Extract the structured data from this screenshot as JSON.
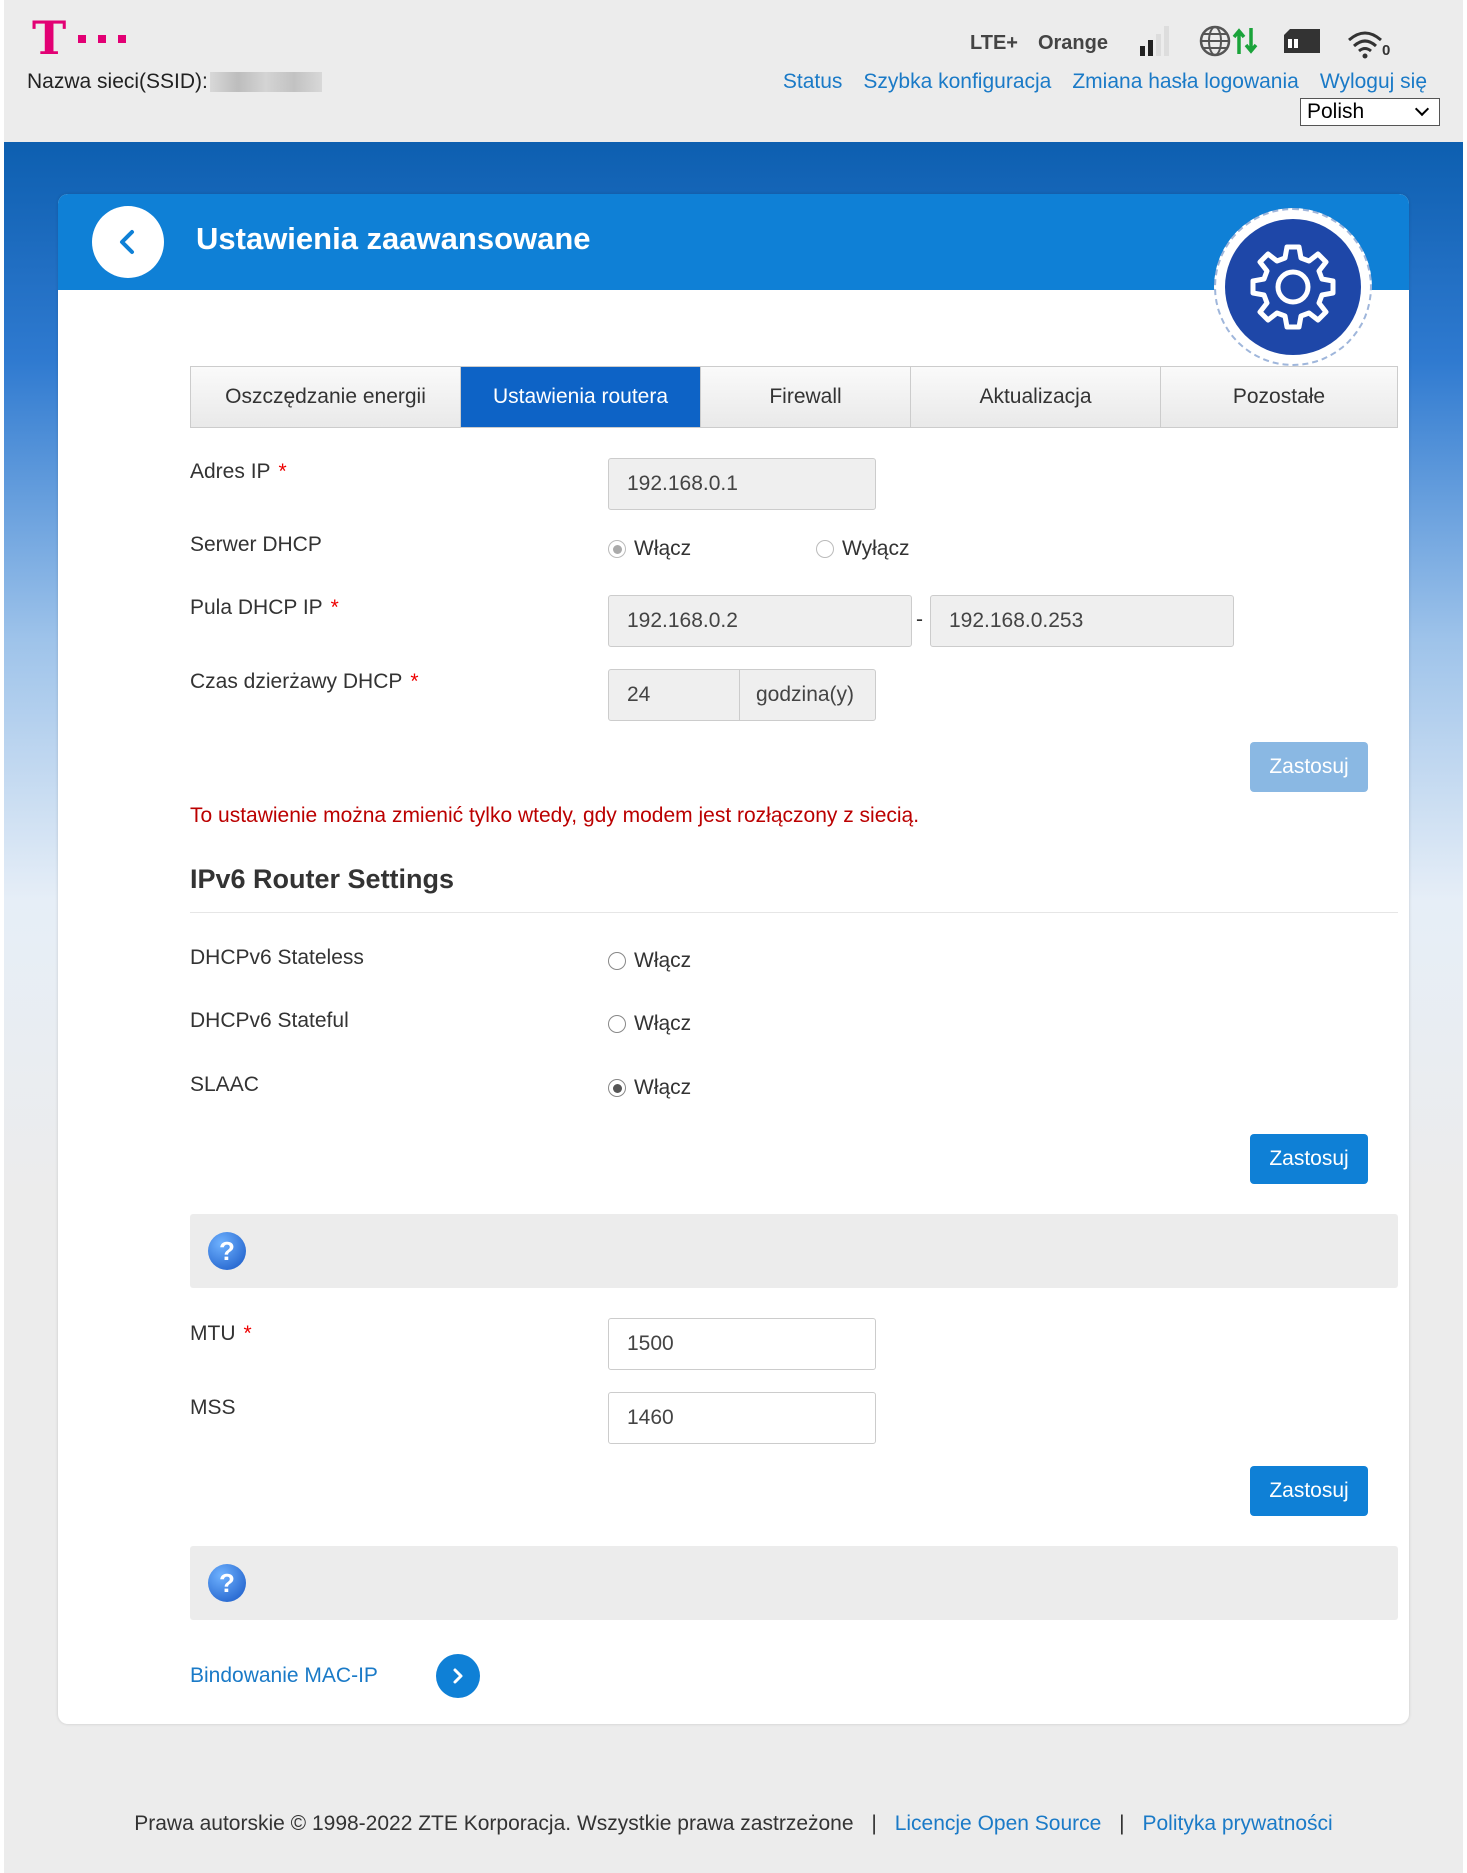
{
  "header": {
    "logo_letter": "T",
    "ssid_label": "Nazwa sieci(SSID):",
    "network_type": "LTE+",
    "operator": "Orange",
    "nav": [
      {
        "label": "Status"
      },
      {
        "label": "Szybka konfiguracja"
      },
      {
        "label": "Zmiana hasła logowania"
      },
      {
        "label": "Wyloguj się"
      }
    ],
    "language": "Polish",
    "wifi_clients": "0",
    "icons": [
      "signal-icon",
      "globe-icon",
      "data-transfer-icon",
      "sim-card-icon",
      "wifi-icon"
    ]
  },
  "card": {
    "title": "Ustawienia zaawansowane",
    "tabs": [
      {
        "label": "Oszczędzanie energii"
      },
      {
        "label": "Ustawienia routera"
      },
      {
        "label": "Firewall"
      },
      {
        "label": "Aktualizacja"
      },
      {
        "label": "Pozostałe"
      }
    ],
    "active_tab": "Ustawienia routera"
  },
  "router": {
    "ip_label": "Adres IP",
    "ip_value": "192.168.0.1",
    "dhcp_label": "Serwer DHCP",
    "dhcp_on": "Włącz",
    "dhcp_off": "Wyłącz",
    "pool_label": "Pula DHCP IP",
    "pool_start": "192.168.0.2",
    "pool_sep": "-",
    "pool_end": "192.168.0.253",
    "lease_label": "Czas dzierżawy DHCP",
    "lease_value": "24",
    "lease_unit": "godzina(y)",
    "apply": "Zastosuj",
    "warning": "To ustawienie można zmienić tylko wtedy, gdy modem jest rozłączony z siecią.",
    "required_mark": "*"
  },
  "ipv6": {
    "title": "IPv6 Router Settings",
    "stateless_label": "DHCPv6 Stateless",
    "stateful_label": "DHCPv6 Stateful",
    "slaac_label": "SLAAC",
    "enable": "Włącz",
    "apply": "Zastosuj"
  },
  "mtu": {
    "help": "?",
    "mtu_label": "MTU",
    "mtu_value": "1500",
    "mss_label": "MSS",
    "mss_value": "1460",
    "apply": "Zastosuj"
  },
  "mac": {
    "help": "?",
    "link": "Bindowanie MAC-IP"
  },
  "footer": {
    "copyright": "Prawa autorskie © 1998-2022 ZTE Korporacja. Wszystkie prawa zastrzeżone",
    "sep": "|",
    "licenses": "Licencje Open Source",
    "privacy": "Polityka prywatności"
  },
  "colors": {
    "brand_magenta": "#e20074",
    "accent_blue": "#0f80d6",
    "warning_red": "#b00000"
  }
}
